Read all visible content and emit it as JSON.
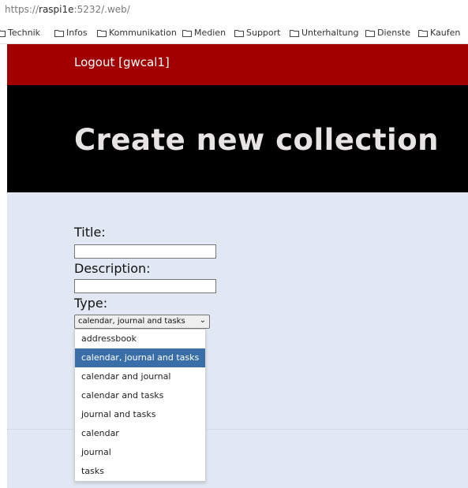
{
  "browser": {
    "url_prefix": "https://",
    "url_host": "raspi1e",
    "url_rest": ":5232/.web/",
    "bookmarks": [
      "Technik",
      "Infos",
      "Kommunikation",
      "Medien",
      "Support",
      "Unterhaltung",
      "Dienste",
      "Kaufen"
    ]
  },
  "header": {
    "logout_label": "Logout [gwcal1]",
    "title": "Create new collection"
  },
  "form": {
    "title_label": "Title:",
    "title_value": "",
    "description_label": "Description:",
    "description_value": "",
    "type_label": "Type:",
    "type_selected": "calendar, journal and tasks",
    "type_options": [
      "addressbook",
      "calendar, journal and tasks",
      "calendar and journal",
      "calendar and tasks",
      "journal and tasks",
      "calendar",
      "journal",
      "tasks"
    ],
    "type_selected_index": 1
  },
  "colors": {
    "topbar": "#a20000",
    "hero": "#000000",
    "page_bg": "#e2e8f3",
    "selection": "#3a6ea8"
  }
}
